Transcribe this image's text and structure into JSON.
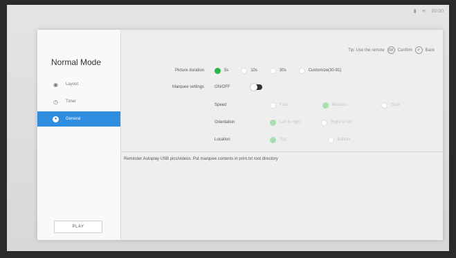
{
  "status": {
    "time": "00:00"
  },
  "sidebar": {
    "title": "Normal Mode",
    "items": [
      {
        "label": "Layout",
        "icon": "layout-icon"
      },
      {
        "label": "Timer",
        "icon": "clock-icon"
      },
      {
        "label": "General",
        "icon": "settings-icon",
        "active": true
      }
    ],
    "play_label": "PLAY"
  },
  "tip": {
    "text": "Tip: Use the remote",
    "confirm_key": "OK",
    "confirm_label": "Confirm",
    "back_key": "↶",
    "back_label": "Back"
  },
  "picture_duration": {
    "label": "Picture duration",
    "options": [
      "5s",
      "10s",
      "30s",
      "Customize(30-91)"
    ],
    "selected": "5s"
  },
  "marquee": {
    "label": "Marquee settings",
    "onoff_label": "ON/OFF",
    "speed": {
      "label": "Speed",
      "options": [
        "Fast",
        "Medium",
        "Slow"
      ],
      "selected": "Medium"
    },
    "orientation": {
      "label": "Orientation",
      "options": [
        "Left to right",
        "Right to left"
      ],
      "selected": "Left to right"
    },
    "location": {
      "label": "Location",
      "options": [
        "Top",
        "Bottom"
      ],
      "selected": "Top"
    }
  },
  "reminder": "Reminder:Autoplay USB pics/videos. Put marquee contents in print.txt root directory"
}
